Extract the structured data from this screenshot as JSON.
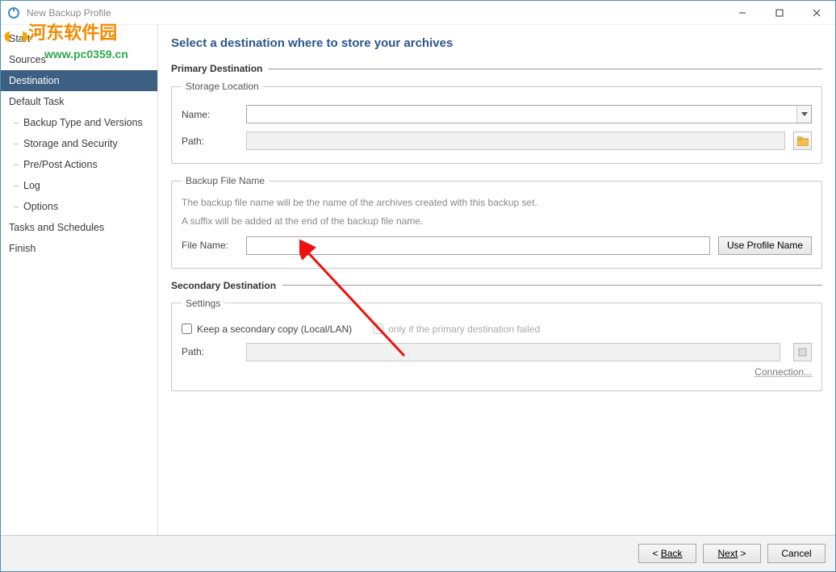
{
  "window": {
    "title": "New Backup Profile"
  },
  "sidebar": {
    "items": [
      {
        "label": "Start"
      },
      {
        "label": "Sources"
      },
      {
        "label": "Destination",
        "active": true
      },
      {
        "label": "Default Task"
      },
      {
        "label": "Tasks and Schedules"
      },
      {
        "label": "Finish"
      }
    ],
    "subitems": [
      {
        "label": "Backup Type and Versions"
      },
      {
        "label": "Storage and Security"
      },
      {
        "label": "Pre/Post Actions"
      },
      {
        "label": "Log"
      },
      {
        "label": "Options"
      }
    ]
  },
  "page": {
    "heading": "Select a destination where to store your archives",
    "primary": {
      "title": "Primary Destination",
      "storage_legend": "Storage Location",
      "name_label": "Name:",
      "name_value": "",
      "path_label": "Path:",
      "path_value": ""
    },
    "backupfile": {
      "legend": "Backup File Name",
      "hint1": "The backup file name will be the name of the archives created with this backup set.",
      "hint2": "A suffix will be added at the end of the backup file name.",
      "file_label": "File Name:",
      "file_value": "",
      "use_profile_btn": "Use Profile Name"
    },
    "secondary": {
      "title": "Secondary Destination",
      "settings_legend": "Settings",
      "keep_copy_label": "Keep a secondary copy (Local/LAN)",
      "only_if_label": "only if the primary destination failed",
      "path_label": "Path:",
      "path_value": "",
      "connection_link": "Connection..."
    }
  },
  "footer": {
    "back": "Back",
    "next": "Next",
    "cancel": "Cancel"
  },
  "watermark": {
    "text": "河东软件园",
    "url": "www.pc0359.cn"
  }
}
